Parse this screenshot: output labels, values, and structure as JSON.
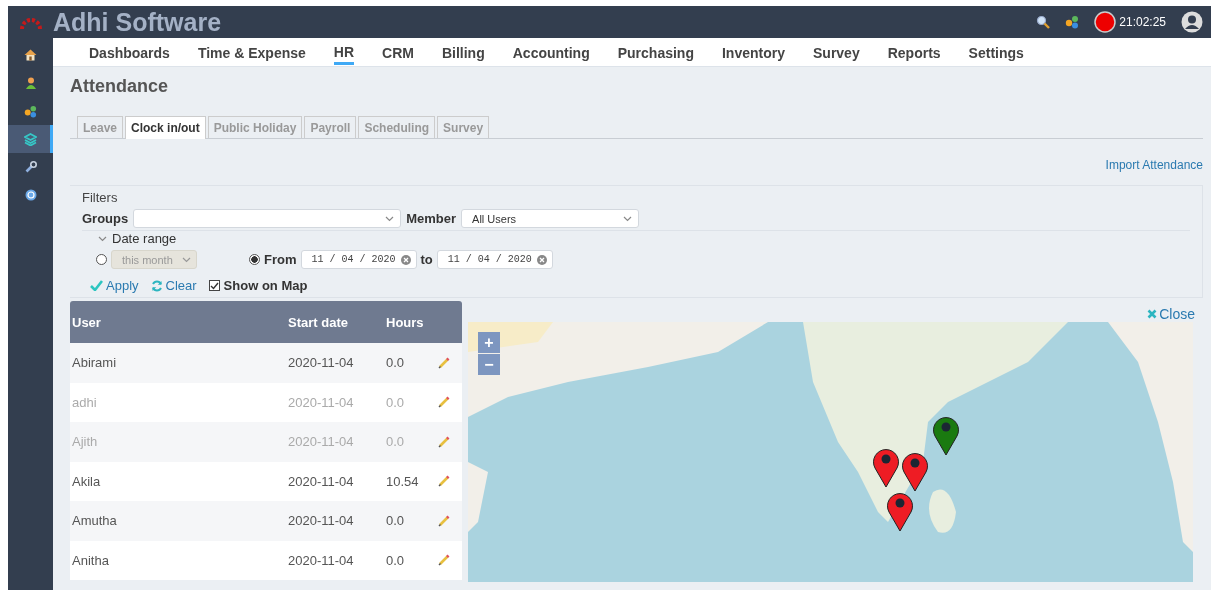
{
  "app": {
    "title": "Adhi Software",
    "clock": "21:02:25"
  },
  "sidebar": {
    "items": [
      {
        "kind": "home",
        "selected": false
      },
      {
        "kind": "user",
        "selected": false
      },
      {
        "kind": "apps",
        "selected": false
      },
      {
        "kind": "hr",
        "selected": true
      },
      {
        "kind": "tools",
        "selected": false
      },
      {
        "kind": "help",
        "selected": false
      }
    ]
  },
  "nav": [
    {
      "label": "Dashboards",
      "selected": false
    },
    {
      "label": "Time & Expense",
      "selected": false
    },
    {
      "label": "HR",
      "selected": true
    },
    {
      "label": "CRM",
      "selected": false
    },
    {
      "label": "Billing",
      "selected": false
    },
    {
      "label": "Accounting",
      "selected": false
    },
    {
      "label": "Purchasing",
      "selected": false
    },
    {
      "label": "Inventory",
      "selected": false
    },
    {
      "label": "Survey",
      "selected": false
    },
    {
      "label": "Reports",
      "selected": false
    },
    {
      "label": "Settings",
      "selected": false
    }
  ],
  "page": {
    "title": "Attendance",
    "import_link": "Import Attendance"
  },
  "tabs": [
    {
      "label": "Leave",
      "selected": false
    },
    {
      "label": "Clock in/out",
      "selected": true
    },
    {
      "label": "Public Holiday",
      "selected": false
    },
    {
      "label": "Payroll",
      "selected": false
    },
    {
      "label": "Scheduling",
      "selected": false
    },
    {
      "label": "Survey",
      "selected": false
    }
  ],
  "filters": {
    "legend": "Filters",
    "groups_label": "Groups",
    "member_label": "Member",
    "member_value": "All Users",
    "date_range_label": "Date range",
    "period_selected": false,
    "period_value": "this month",
    "from_selected": true,
    "from_label": "From",
    "from_date": "11 / 04 / 2020",
    "to_label": "to",
    "to_date": "11 / 04 / 2020",
    "apply": "Apply",
    "clear": "Clear",
    "show_on_map": "Show on Map",
    "show_on_map_checked": true
  },
  "table": {
    "columns": [
      "User",
      "Start date",
      "Hours"
    ],
    "rows": [
      {
        "user": "Abirami",
        "start_date": "2020-11-04",
        "hours": "0.0",
        "inactive": false
      },
      {
        "user": "adhi",
        "start_date": "2020-11-04",
        "hours": "0.0",
        "inactive": true
      },
      {
        "user": "Ajith",
        "start_date": "2020-11-04",
        "hours": "0.0",
        "inactive": true
      },
      {
        "user": "Akila",
        "start_date": "2020-11-04",
        "hours": "10.54",
        "inactive": false
      },
      {
        "user": "Amutha",
        "start_date": "2020-11-04",
        "hours": "0.0",
        "inactive": false
      },
      {
        "user": "Anitha",
        "start_date": "2020-11-04",
        "hours": "0.0",
        "inactive": false
      }
    ]
  },
  "map": {
    "close": "Close",
    "zoom_in": "+",
    "zoom_out": "−",
    "markers": [
      {
        "color": "#1a7a10"
      },
      {
        "color": "#ee1c24"
      },
      {
        "color": "#ee1c24"
      },
      {
        "color": "#ee1c24"
      }
    ]
  }
}
